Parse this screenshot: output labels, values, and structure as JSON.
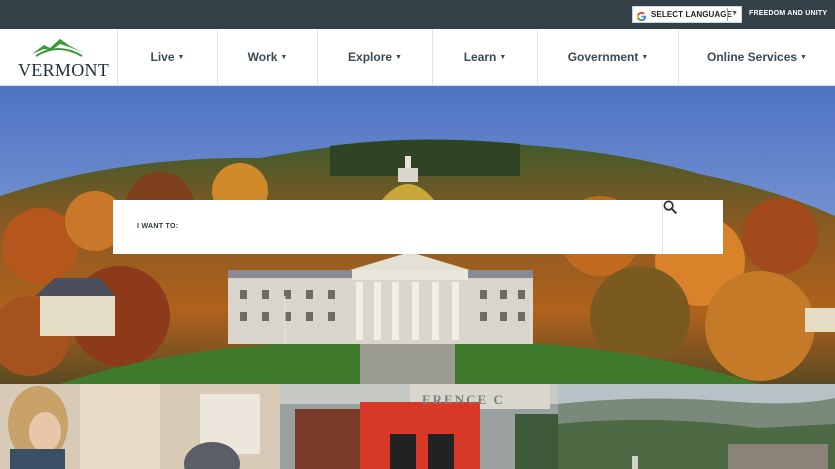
{
  "topbar": {
    "language_label": "SELECT LANGUAGE",
    "motto": "FREEDOM AND UNITY"
  },
  "logo": {
    "text": "VERMONT"
  },
  "nav": {
    "items": [
      {
        "label": "Live"
      },
      {
        "label": "Work"
      },
      {
        "label": "Explore"
      },
      {
        "label": "Learn"
      },
      {
        "label": "Government"
      },
      {
        "label": "Online Services"
      }
    ]
  },
  "search": {
    "label": "I WANT TO:",
    "value": ""
  },
  "tiles": {
    "ambulance_sign": "ERENCE C"
  },
  "colors": {
    "topbar_bg": "#344048",
    "nav_text": "#3a4a56",
    "logo_green": "#3a9a3a"
  }
}
